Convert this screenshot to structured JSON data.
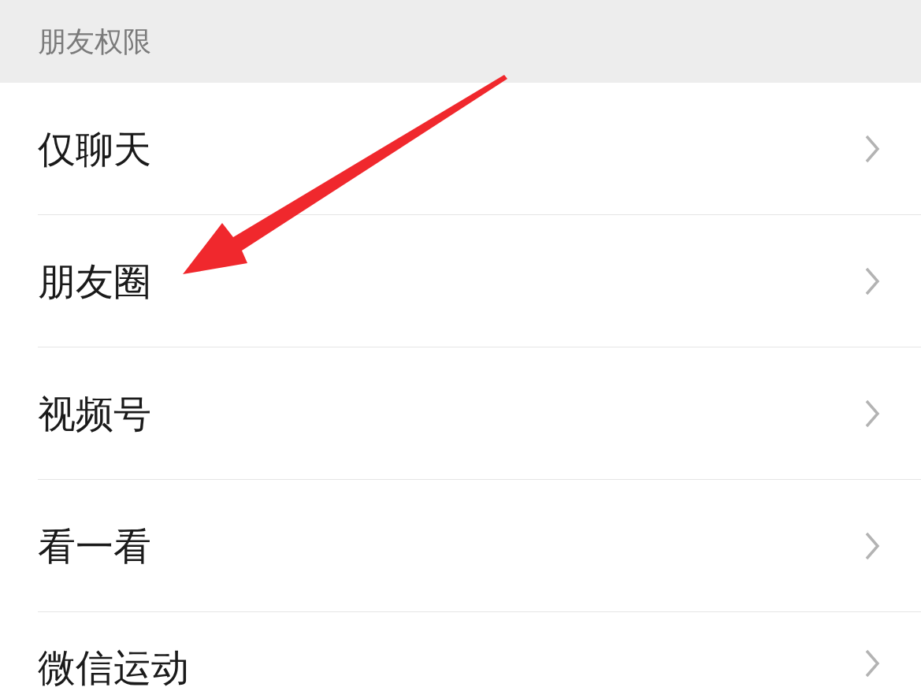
{
  "section_header": {
    "title": "朋友权限"
  },
  "items": [
    {
      "label": "仅聊天"
    },
    {
      "label": "朋友圈"
    },
    {
      "label": "视频号"
    },
    {
      "label": "看一看"
    },
    {
      "label": "微信运动"
    }
  ]
}
